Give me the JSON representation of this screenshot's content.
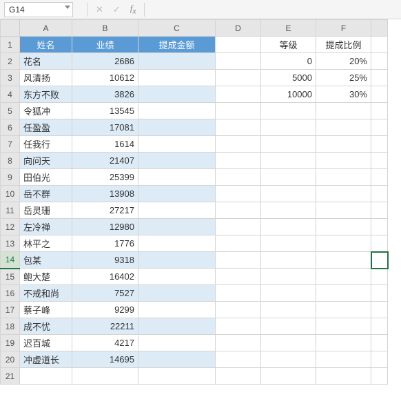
{
  "formula_bar": {
    "cell_ref": "G14",
    "cancel_icon": "✕",
    "confirm_icon": "✓",
    "fx_label_f": "f",
    "fx_label_x": "x"
  },
  "columns": [
    "A",
    "B",
    "C",
    "D",
    "E",
    "F",
    ""
  ],
  "main_table": {
    "headers": {
      "name": "姓名",
      "perf": "业绩",
      "comm": "提成金额"
    },
    "rows": [
      {
        "name": "花名",
        "perf": "2686"
      },
      {
        "name": "风清扬",
        "perf": "10612"
      },
      {
        "name": "东方不败",
        "perf": "3826"
      },
      {
        "name": "令狐冲",
        "perf": "13545"
      },
      {
        "name": "任盈盈",
        "perf": "17081"
      },
      {
        "name": "任我行",
        "perf": "1614"
      },
      {
        "name": "向问天",
        "perf": "21407"
      },
      {
        "name": "田伯光",
        "perf": "25399"
      },
      {
        "name": "岳不群",
        "perf": "13908"
      },
      {
        "name": "岳灵珊",
        "perf": "27217"
      },
      {
        "name": "左冷禅",
        "perf": "12980"
      },
      {
        "name": "林平之",
        "perf": "1776"
      },
      {
        "name": "包某",
        "perf": "9318"
      },
      {
        "name": "鲍大楚",
        "perf": "16402"
      },
      {
        "name": "不戒和尚",
        "perf": "7527"
      },
      {
        "name": "蔡子峰",
        "perf": "9299"
      },
      {
        "name": "成不忧",
        "perf": "22211"
      },
      {
        "name": "迟百城",
        "perf": "4217"
      },
      {
        "name": "冲虚道长",
        "perf": "14695"
      }
    ]
  },
  "lookup_table": {
    "headers": {
      "level": "等级",
      "ratio": "提成比例"
    },
    "rows": [
      {
        "level": "0",
        "ratio": "20%"
      },
      {
        "level": "5000",
        "ratio": "25%"
      },
      {
        "level": "10000",
        "ratio": "30%"
      }
    ]
  },
  "chart_data": {
    "type": "table",
    "title": "",
    "tables": [
      {
        "columns": [
          "姓名",
          "业绩",
          "提成金额"
        ],
        "data": [
          [
            "花名",
            2686,
            null
          ],
          [
            "风清扬",
            10612,
            null
          ],
          [
            "东方不败",
            3826,
            null
          ],
          [
            "令狐冲",
            13545,
            null
          ],
          [
            "任盈盈",
            17081,
            null
          ],
          [
            "任我行",
            1614,
            null
          ],
          [
            "向问天",
            21407,
            null
          ],
          [
            "田伯光",
            25399,
            null
          ],
          [
            "岳不群",
            13908,
            null
          ],
          [
            "岳灵珊",
            27217,
            null
          ],
          [
            "左冷禅",
            12980,
            null
          ],
          [
            "林平之",
            1776,
            null
          ],
          [
            "包某",
            9318,
            null
          ],
          [
            "鲍大楚",
            16402,
            null
          ],
          [
            "不戒和尚",
            7527,
            null
          ],
          [
            "蔡子峰",
            9299,
            null
          ],
          [
            "成不忧",
            22211,
            null
          ],
          [
            "迟百城",
            4217,
            null
          ],
          [
            "冲虚道长",
            14695,
            null
          ]
        ]
      },
      {
        "columns": [
          "等级",
          "提成比例"
        ],
        "data": [
          [
            0,
            0.2
          ],
          [
            5000,
            0.25
          ],
          [
            10000,
            0.3
          ]
        ]
      }
    ]
  }
}
